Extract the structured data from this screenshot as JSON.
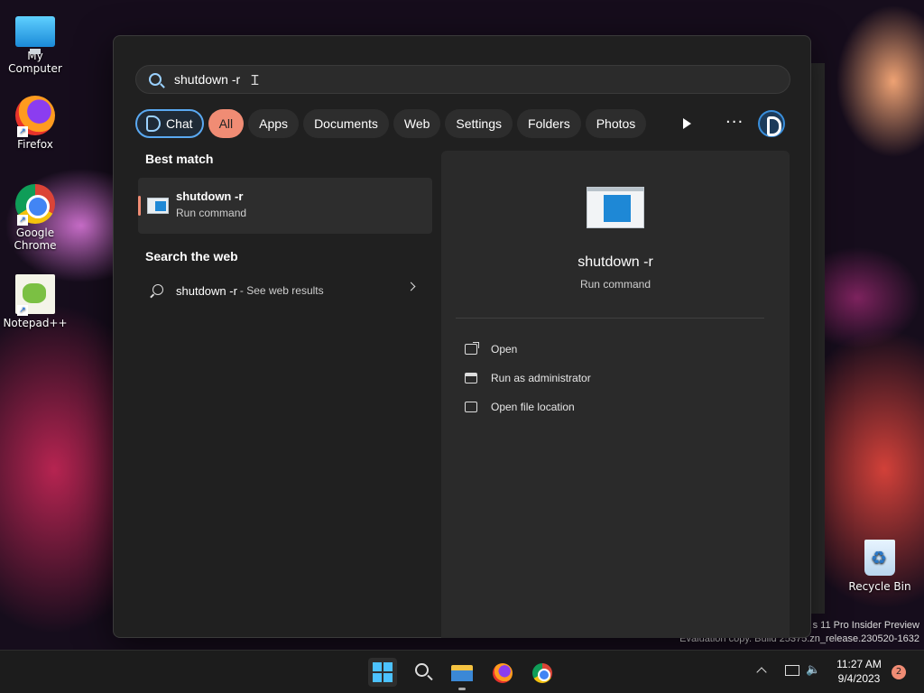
{
  "desktop": {
    "icons": [
      {
        "label": "My Computer",
        "icon": "computer-icon"
      },
      {
        "label": "Firefox",
        "icon": "firefox-icon"
      },
      {
        "label": "Google Chrome",
        "icon": "chrome-icon"
      },
      {
        "label": "Notepad++",
        "icon": "notepad-icon"
      }
    ],
    "recycle_bin": "Recycle Bin",
    "watermark_line1": "s 11 Pro Insider Preview",
    "watermark_line2": "Evaluation copy. Build 25375.zn_release.230520-1632"
  },
  "search": {
    "query": "shutdown -r"
  },
  "filters": {
    "chat": "Chat",
    "all": "All",
    "apps": "Apps",
    "documents": "Documents",
    "web": "Web",
    "settings": "Settings",
    "folders": "Folders",
    "photos": "Photos",
    "more": "···"
  },
  "results": {
    "best_match_title": "Best match",
    "best_match": {
      "name": "shutdown -r",
      "type": "Run command"
    },
    "web_title": "Search the web",
    "web_result": {
      "query": "shutdown -r",
      "suffix": "- See web results"
    }
  },
  "preview": {
    "name": "shutdown -r",
    "type": "Run command",
    "actions": [
      "Open",
      "Run as administrator",
      "Open file location"
    ]
  },
  "taskbar": {
    "time": "11:27 AM",
    "date": "9/4/2023",
    "notification_count": "2"
  },
  "colors": {
    "accent": "#f08c74",
    "panel_bg": "#202020",
    "chat_border": "#5aa9f2"
  }
}
